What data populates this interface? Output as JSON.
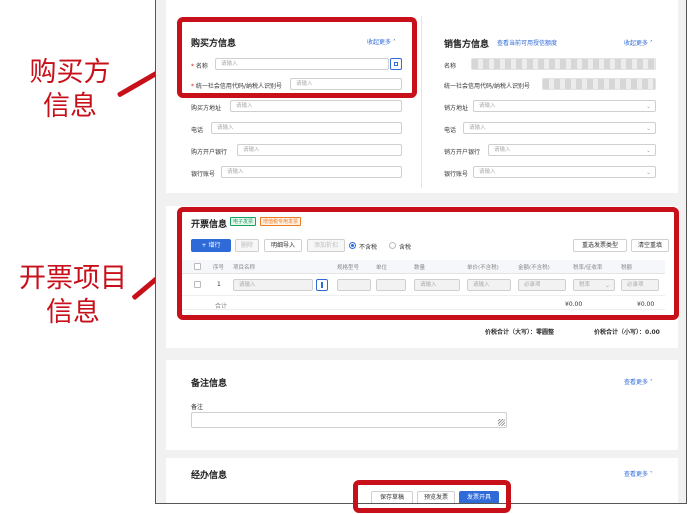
{
  "annotations": {
    "buyer_callout": "购买方\n信息",
    "items_callout": "开票项目\n信息"
  },
  "colors": {
    "highlight": "#c8101b",
    "primary": "#2f6bd8",
    "tag_green": "#19a15f",
    "tag_orange": "#f07b20"
  },
  "buyer": {
    "title": "购买方信息",
    "collapse_link": "收起更多",
    "name_label": "名称",
    "name_placeholder": "请输入",
    "tax_id_label": "统一社会信用代码/纳税人识别号",
    "tax_id_placeholder": "请输入",
    "address_label": "购买方地址",
    "address_placeholder": "请输入",
    "phone_label": "电话",
    "phone_placeholder": "请输入",
    "bank_label": "购方开户银行",
    "bank_placeholder": "请输入",
    "account_label": "银行账号",
    "account_placeholder": "请输入"
  },
  "seller": {
    "title": "销售方信息",
    "quota_link": "查看当前可用授信额度",
    "collapse_link": "收起更多",
    "name_label": "名称",
    "tax_id_label": "统一社会信用代码/纳税人识别号",
    "address_label": "销方地址",
    "address_placeholder": "请输入",
    "phone_label": "电话",
    "phone_placeholder": "请输入",
    "bank_label": "销方开户银行",
    "bank_placeholder": "请输入",
    "account_label": "银行账号",
    "account_placeholder": "请输入"
  },
  "ticket": {
    "title": "开票信息",
    "tag_electronic": "电子发票",
    "tag_special": "增值税专用发票",
    "toolbar": {
      "add_row": "增行",
      "delete": "删除",
      "import_detail": "明细导入",
      "add_discount": "添加折扣",
      "tax_exclusive": "不含税",
      "tax_inclusive": "含税",
      "reselect_type": "重选发票类型",
      "clear_reset": "清空重填"
    },
    "columns": [
      "序号",
      "项目名称",
      "规格型号",
      "单位",
      "数量",
      "单价(不含税)",
      "金额(不含税)",
      "税率/征收率",
      "税额"
    ],
    "row": {
      "index": "1",
      "name_placeholder": "请输入",
      "qty_placeholder": "请输入",
      "price_placeholder": "请输入",
      "amount_placeholder": "必录项",
      "rate_placeholder": "税率",
      "tax_placeholder": "必录项"
    },
    "subtotal_label": "合计",
    "subtotal_amount": "¥0.00",
    "subtotal_tax": "¥0.00",
    "total_upper_label": "价税合计（大写）：",
    "total_upper_value": "零圆整",
    "total_lower_label": "价税合计（小写）：",
    "total_lower_value": "0.00"
  },
  "remark": {
    "title": "备注信息",
    "more_link": "查看更多",
    "field_label": "备注"
  },
  "handler": {
    "title": "经办信息",
    "more_link": "查看更多"
  },
  "footer": {
    "save_draft": "保存草稿",
    "preview": "预览发票",
    "issue": "发票开具"
  }
}
